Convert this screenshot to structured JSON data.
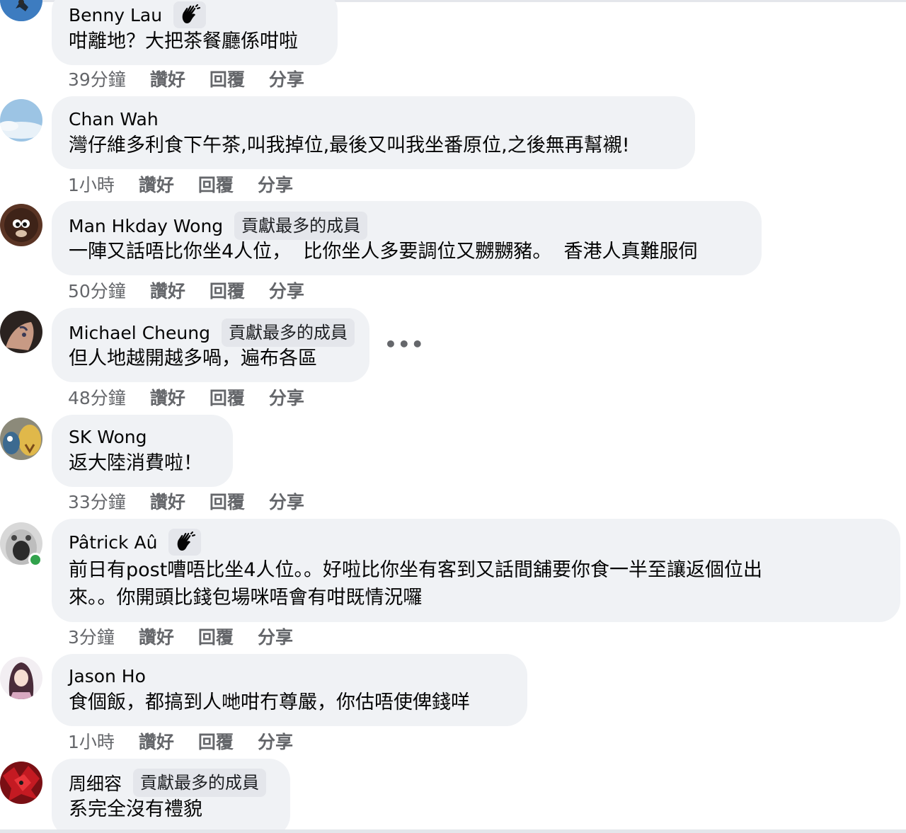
{
  "comments": [
    {
      "name": "Benny Lau",
      "badge": "",
      "text": "咁離地？大把茶餐廳係咁啦",
      "time": "39分鐘",
      "like": "讚好",
      "reply": "回覆",
      "share": "分享"
    },
    {
      "name": "Chan Wah",
      "badge": "",
      "text": "灣仔維多利食下午茶,叫我掉位,最後又叫我坐番原位,之後無再幫襯!",
      "time": "1小時",
      "like": "讚好",
      "reply": "回覆",
      "share": "分享"
    },
    {
      "name": "Man Hkday Wong",
      "badge": "貢獻最多的成員",
      "text": "一陣又話唔比你坐4人位，  比你坐人多要調位又嬲嬲豬。  香港人真難服伺",
      "time": "50分鐘",
      "like": "讚好",
      "reply": "回覆",
      "share": "分享"
    },
    {
      "name": "Michael Cheung",
      "badge": "貢獻最多的成員",
      "text": "但人地越開越多喎，遍布各區",
      "time": "48分鐘",
      "like": "讚好",
      "reply": "回覆",
      "share": "分享",
      "more": "•••"
    },
    {
      "name": "SK Wong",
      "badge": "",
      "text": "返大陸消費啦！",
      "time": "33分鐘",
      "like": "讚好",
      "reply": "回覆",
      "share": "分享"
    },
    {
      "name": "Pâtrick Aû",
      "badge": "",
      "text_line1": "前日有post嘈唔比坐4人位。。好啦比你坐有客到又話間舖要你食一半至讓返個位出",
      "text_line2": "來。。你開頭比錢包場咪唔會有咁既情況囉",
      "time": "3分鐘",
      "like": "讚好",
      "reply": "回覆",
      "share": "分享"
    },
    {
      "name": "Jason Ho",
      "badge": "",
      "text": "食個飯，都搞到人哋咁冇尊嚴，你估唔使俾錢咩",
      "time": "1小時",
      "like": "讚好",
      "reply": "回覆",
      "share": "分享"
    },
    {
      "name": "周细容",
      "badge": "貢獻最多的成員",
      "text": "系完全沒有禮貌"
    }
  ],
  "icons": {
    "wave": "waving-hand-icon",
    "more": "more-options-icon",
    "online": "online-status-icon"
  },
  "colors": {
    "bubble": "#f0f2f5",
    "badge": "#e4e6eb",
    "meta": "#65676b",
    "online": "#31a24c"
  }
}
